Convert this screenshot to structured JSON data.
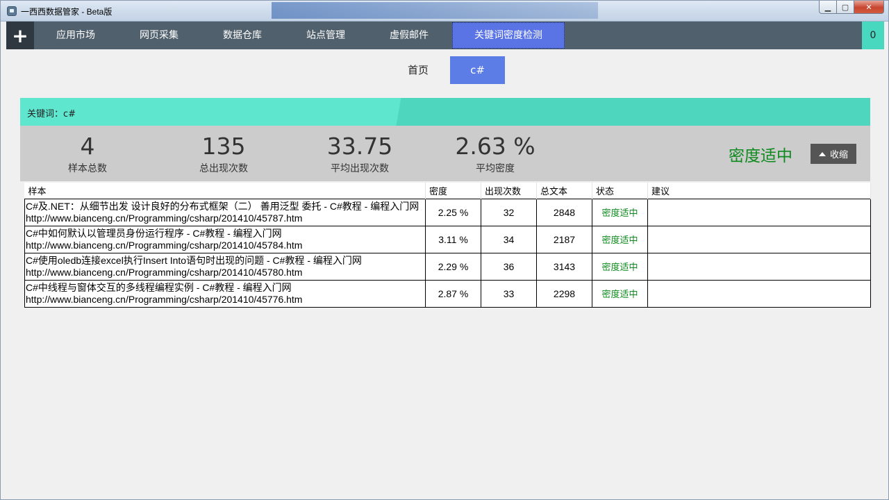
{
  "window": {
    "title": "一西西数据管家  -  Beta版",
    "minimize": "▁",
    "maximize": "▢",
    "close": "✕"
  },
  "nav": {
    "plus": "+",
    "items": [
      "应用市场",
      "网页采集",
      "数据仓库",
      "站点管理",
      "虚假邮件",
      "关键词密度检测"
    ],
    "active_index": 5,
    "badge": "0"
  },
  "tabs": {
    "home": "首页",
    "current": "c#"
  },
  "keyword": {
    "label": "关键词：c#"
  },
  "stats": {
    "sample_total": {
      "value": "4",
      "label": "样本总数"
    },
    "total_occurrences": {
      "value": "135",
      "label": "总出现次数"
    },
    "avg_occurrences": {
      "value": "33.75",
      "label": "平均出现次数"
    },
    "avg_density": {
      "value": "2.63 %",
      "label": "平均密度"
    },
    "status": "密度适中",
    "collapse_label": "收缩"
  },
  "table": {
    "columns": [
      "样本",
      "密度",
      "出现次数",
      "总文本",
      "状态",
      "建议"
    ],
    "rows": [
      {
        "title": "C#及.NET：从细节出发 设计良好的分布式框架（二） 善用泛型 委托 - C#教程 - 编程入门网",
        "url": "http://www.bianceng.cn/Programming/csharp/201410/45787.htm",
        "density": "2.25 %",
        "count": "32",
        "total": "2848",
        "status": "密度适中",
        "advice": ""
      },
      {
        "title": "C#中如何默认以管理员身份运行程序 - C#教程 - 编程入门网",
        "url": "http://www.bianceng.cn/Programming/csharp/201410/45784.htm",
        "density": "3.11 %",
        "count": "34",
        "total": "2187",
        "status": "密度适中",
        "advice": ""
      },
      {
        "title": "C#使用oledb连接excel执行Insert Into语句时出现的问题 - C#教程 - 编程入门网",
        "url": "http://www.bianceng.cn/Programming/csharp/201410/45780.htm",
        "density": "2.29 %",
        "count": "36",
        "total": "3143",
        "status": "密度适中",
        "advice": ""
      },
      {
        "title": "C#中线程与窗体交互的多线程编程实例 - C#教程 - 编程入门网",
        "url": "http://www.bianceng.cn/Programming/csharp/201410/45776.htm",
        "density": "2.87 %",
        "count": "33",
        "total": "2298",
        "status": "密度适中",
        "advice": ""
      }
    ]
  },
  "colors": {
    "nav_bg": "#51606d",
    "nav_active": "#5a74e6",
    "keyword_bar": "#5fe6cf",
    "status_green": "#0e8a1e"
  }
}
